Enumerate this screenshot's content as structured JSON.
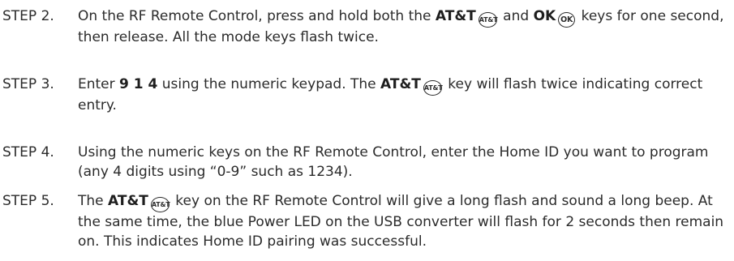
{
  "steps": [
    {
      "label": "STEP 2.",
      "t1": "On the RF Remote Control, press and hold both the ",
      "b1": "AT&T",
      "icon1": "AT&T",
      "t2": " and ",
      "b2": "OK",
      "icon2": "OK",
      "t3": " keys for one second, then release.  All the mode keys flash twice."
    },
    {
      "label": "STEP 3.",
      "t1": "Enter ",
      "b1": "9 1 4",
      "t2": " using the numeric keypad. The ",
      "b2": "AT&T",
      "icon1": "AT&T",
      "t3": " key will flash twice indicating correct entry."
    },
    {
      "label": "STEP 4.",
      "t1": "Using the numeric keys on the RF Remote Control, enter the Home ID you want to program (any 4 digits using “0-9” such as 1234)."
    },
    {
      "label": "STEP 5.",
      "t1": "The ",
      "b1": "AT&T",
      "icon1": "AT&T",
      "t2": " key on the RF Remote Control will give a long flash and sound a long beep.  At the same time, the blue Power LED on the USB converter will flash for 2 seconds then remain on. This indicates Home ID pairing was successful."
    }
  ]
}
